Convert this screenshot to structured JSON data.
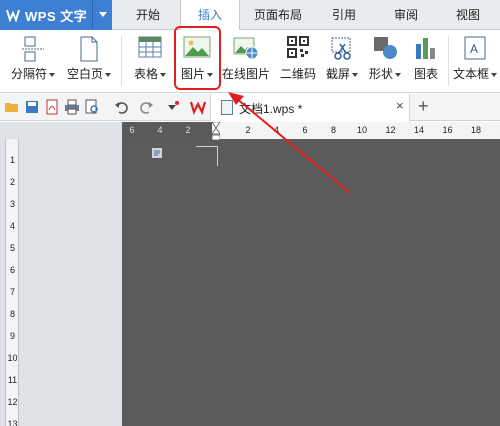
{
  "app": {
    "title": "WPS 文字"
  },
  "tabs": [
    {
      "label": "开始",
      "active": false
    },
    {
      "label": "插入",
      "active": true
    },
    {
      "label": "页面布局",
      "active": false
    },
    {
      "label": "引用",
      "active": false
    },
    {
      "label": "审阅",
      "active": false
    },
    {
      "label": "视图",
      "active": false
    }
  ],
  "ribbon": {
    "page_break": "分隔符",
    "blank_page": "空白页",
    "table": "表格",
    "picture": "图片",
    "online_picture": "在线图片",
    "qrcode": "二维码",
    "screenshot": "截屏",
    "shapes": "形状",
    "chart": "图表",
    "textbox": "文本框"
  },
  "document": {
    "tab_name": "文档1.wps *",
    "close_glyph": "×",
    "new_tab_glyph": "+"
  },
  "ruler": {
    "h_dark_left": [
      "6",
      "4",
      "2"
    ],
    "h_white": [
      "2",
      "4",
      "6",
      "8",
      "10",
      "12",
      "14",
      "16",
      "18",
      "20"
    ],
    "v": [
      "1",
      "2",
      "3",
      "4",
      "5",
      "6",
      "7",
      "8",
      "9",
      "10",
      "11",
      "12",
      "13"
    ]
  },
  "icons": {
    "app_logo": "wps-logo-icon",
    "open": "folder-open-icon",
    "save": "save-icon",
    "pdf": "export-pdf-icon",
    "print": "print-icon",
    "undo": "undo-icon",
    "redo": "redo-icon"
  },
  "colors": {
    "accent": "#3c7fd3",
    "annotation": "#e02020",
    "canvas_dark": "#5b5b5b"
  }
}
